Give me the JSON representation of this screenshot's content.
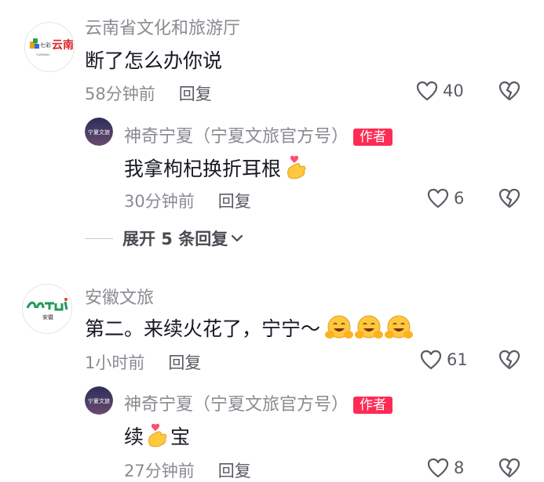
{
  "comments": [
    {
      "author": "云南省文化和旅游厅",
      "avatar_text": "七彩 云南",
      "text": "断了怎么办你说",
      "time": "58分钟前",
      "reply_label": "回复",
      "likes": "40",
      "replies": [
        {
          "author": "神奇宁夏（宁夏文旅官方号）",
          "badge": "作者",
          "avatar_text": "宁夏文旅",
          "text": "我拿枸杞换折耳根",
          "time": "30分钟前",
          "reply_label": "回复",
          "likes": "6"
        }
      ],
      "expand_label": "展开 5 条回复"
    },
    {
      "author": "安徽文旅",
      "avatar_text": "安徽",
      "text": "第二。来续火花了，宁宁～",
      "time": "1小时前",
      "reply_label": "回复",
      "likes": "61",
      "replies": [
        {
          "author": "神奇宁夏（宁夏文旅官方号）",
          "badge": "作者",
          "avatar_text": "宁夏文旅",
          "text_before": "续",
          "text_after": "宝",
          "time": "27分钟前",
          "reply_label": "回复",
          "likes": "8"
        }
      ]
    }
  ],
  "colors": {
    "secondary_text": "#8a8b91",
    "author_badge": "#fe2c55",
    "primary_text": "#161823"
  },
  "icons": {
    "like": "heart-outline-icon",
    "dislike": "broken-heart-icon",
    "expand": "chevron-down-icon"
  }
}
